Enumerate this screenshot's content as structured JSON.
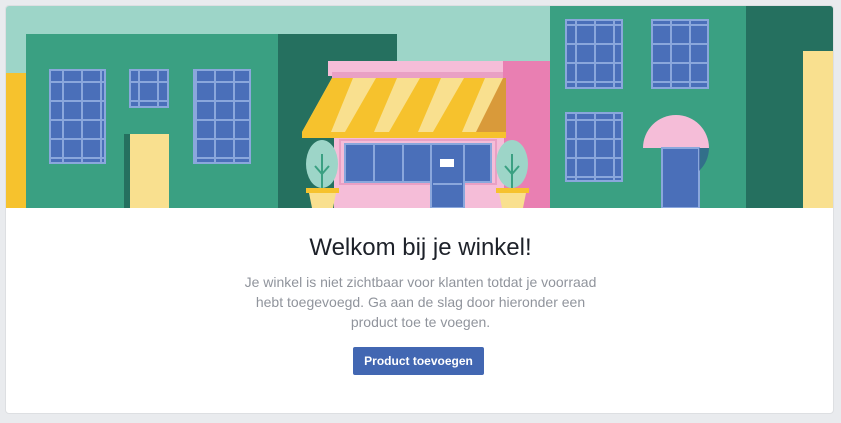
{
  "welcome": {
    "title": "Welkom bij je winkel!",
    "description": "Je winkel is niet zichtbaar voor klanten totdat je voorraad hebt toegevoegd. Ga aan de slag door hieronder een product toe te voegen.",
    "button_label": "Product toevoegen"
  },
  "colors": {
    "accent": "#4267b2",
    "title": "#1d2129",
    "description": "#90949c",
    "sky": "#9dd5c8",
    "building_green": "#3aa082",
    "building_dark": "#25705f",
    "shop_pink": "#f5bdd8",
    "awning_yellow": "#f6c22d",
    "window_blue": "#4a6fb9"
  }
}
